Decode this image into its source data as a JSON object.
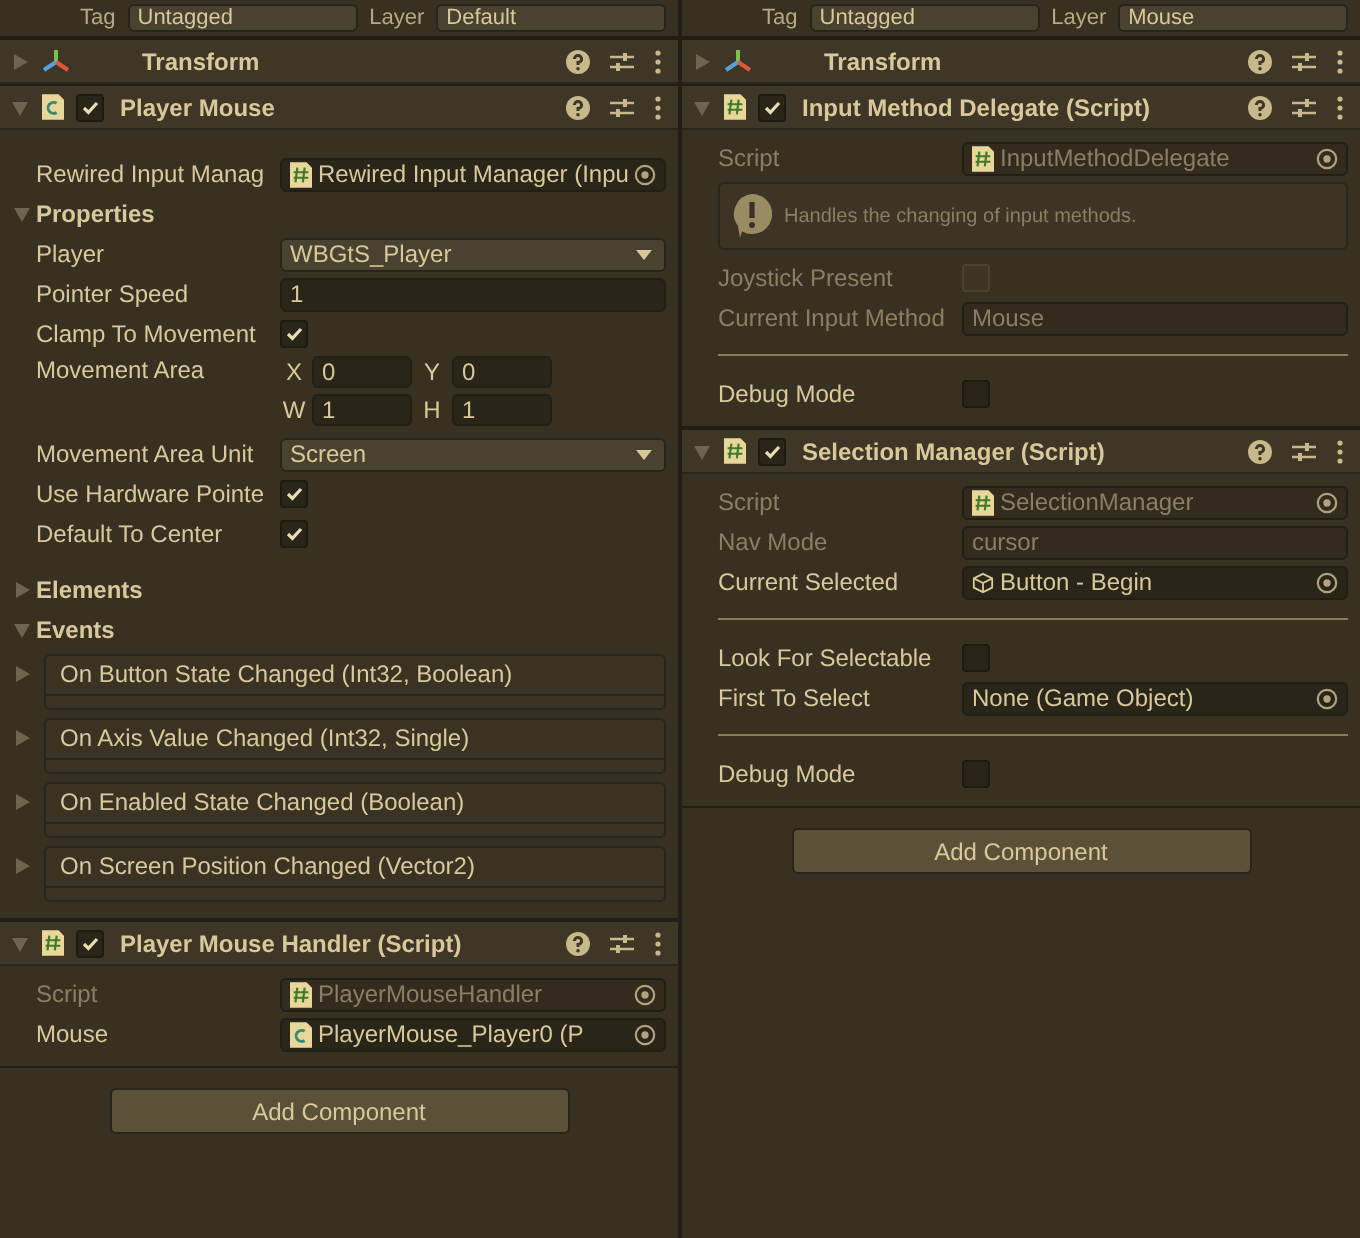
{
  "panels": [
    {
      "tag_label": "Tag",
      "tag_value": "Untagged",
      "layer_label": "Layer",
      "layer_value": "Default",
      "components": [
        {
          "name": "Transform",
          "kind": "transform",
          "expanded": false
        },
        {
          "name": "Player Mouse",
          "kind": "component",
          "expanded": true,
          "enabled": true,
          "rows": [
            {
              "kind": "spacer"
            },
            {
              "kind": "script_ref",
              "label": "Rewired Input Manag",
              "value": "Rewired Input Manager (Inpu",
              "disabled": false
            },
            {
              "kind": "foldout",
              "label": "Properties",
              "expanded": true
            },
            {
              "kind": "dropdown",
              "label": "Player",
              "value": "WBGtS_Player"
            },
            {
              "kind": "text",
              "label": "Pointer Speed",
              "value": "1",
              "disabled": false
            },
            {
              "kind": "checkbox",
              "label": "Clamp To Movement",
              "checked": true,
              "disabled": false
            },
            {
              "kind": "rect",
              "label": "Movement Area",
              "fields": [
                {
                  "label": "X",
                  "value": "0"
                },
                {
                  "label": "Y",
                  "value": "0"
                },
                {
                  "label": "W",
                  "value": "1"
                },
                {
                  "label": "H",
                  "value": "1"
                }
              ]
            },
            {
              "kind": "dropdown",
              "label": "Movement Area Unit",
              "value": "Screen"
            },
            {
              "kind": "checkbox",
              "label": "Use Hardware Pointe",
              "checked": true,
              "disabled": false
            },
            {
              "kind": "checkbox",
              "label": "Default To Center",
              "checked": true,
              "disabled": false
            },
            {
              "kind": "spacer"
            },
            {
              "kind": "foldout",
              "label": "Elements",
              "expanded": false
            },
            {
              "kind": "foldout",
              "label": "Events",
              "expanded": true
            },
            {
              "kind": "event",
              "label": "On Button State Changed (Int32, Boolean)"
            },
            {
              "kind": "event",
              "label": "On Axis Value Changed (Int32, Single)"
            },
            {
              "kind": "event",
              "label": "On Enabled State Changed (Boolean)"
            },
            {
              "kind": "event",
              "label": "On Screen Position Changed (Vector2)"
            }
          ]
        },
        {
          "name": "Player Mouse Handler (Script)",
          "kind": "script",
          "expanded": true,
          "enabled": true,
          "rows": [
            {
              "kind": "script_ref",
              "label": "Script",
              "value": "PlayerMouseHandler",
              "disabled": true
            },
            {
              "kind": "component_ref",
              "label": "Mouse",
              "value": "PlayerMouse_Player0 (P",
              "disabled": false
            }
          ]
        }
      ],
      "add_button": "Add Component"
    },
    {
      "tag_label": "Tag",
      "tag_value": "Untagged",
      "layer_label": "Layer",
      "layer_value": "Mouse",
      "components": [
        {
          "name": "Transform",
          "kind": "transform",
          "expanded": false
        },
        {
          "name": "Input Method Delegate (Script)",
          "kind": "script",
          "expanded": true,
          "enabled": true,
          "rows": [
            {
              "kind": "script_ref",
              "label": "Script",
              "value": "InputMethodDelegate",
              "disabled": true
            },
            {
              "kind": "help",
              "text": "Handles the changing of input methods."
            },
            {
              "kind": "checkbox",
              "label": "Joystick Present",
              "checked": false,
              "disabled": true
            },
            {
              "kind": "text",
              "label": "Current Input Method",
              "value": "Mouse",
              "disabled": true
            },
            {
              "kind": "divider"
            },
            {
              "kind": "checkbox",
              "label": "Debug Mode",
              "checked": false,
              "disabled": false
            }
          ]
        },
        {
          "name": "Selection Manager (Script)",
          "kind": "script",
          "expanded": true,
          "enabled": true,
          "rows": [
            {
              "kind": "script_ref",
              "label": "Script",
              "value": "SelectionManager",
              "disabled": true
            },
            {
              "kind": "text",
              "label": "Nav Mode",
              "value": "cursor",
              "disabled": true
            },
            {
              "kind": "object_ref",
              "label": "Current Selected",
              "value": "Button - Begin",
              "disabled": false
            },
            {
              "kind": "divider"
            },
            {
              "kind": "checkbox",
              "label": "Look For Selectable",
              "checked": false,
              "disabled": false
            },
            {
              "kind": "none_ref",
              "label": "First To Select",
              "value": "None (Game Object)",
              "disabled": false
            },
            {
              "kind": "divider"
            },
            {
              "kind": "checkbox",
              "label": "Debug Mode",
              "checked": false,
              "disabled": false
            }
          ]
        }
      ],
      "add_button": "Add Component"
    }
  ]
}
